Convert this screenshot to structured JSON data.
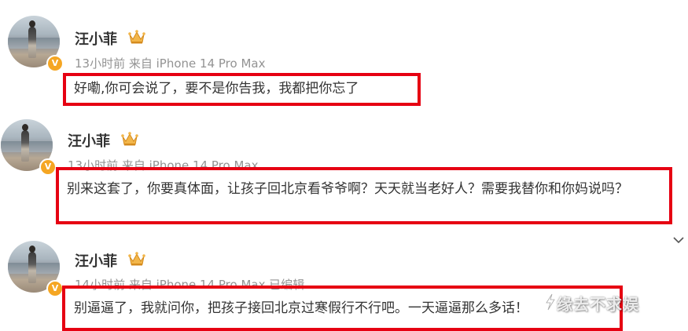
{
  "comments": [
    {
      "username": "汪小菲",
      "meta": "13小时前 来自 iPhone 14 Pro Max",
      "content": "好嘞,你可会说了，要不是你告我，我都把你忘了"
    },
    {
      "username": "汪小菲",
      "meta": "13小时前 来自 iPhone 14 Pro Max",
      "content": "别来这套了，你要真体面，让孩子回北京看爷爷啊？天天就当老好人？需要我替你和你妈说吗？"
    },
    {
      "username": "汪小菲",
      "meta": "14小时前 来自 iPhone 14 Pro Max 已编辑",
      "content": "别逼逼了，我就问你，把孩子接回北京过寒假行不行吧。一天逼逼那么多话！"
    }
  ],
  "verified_badge": "V",
  "watermark": "缘去不求娱",
  "colors": {
    "highlight": "#e60012",
    "meta": "#939393",
    "text": "#333333",
    "badge": "#f5a623"
  },
  "icons": [
    "crown-icon",
    "verified-badge-icon",
    "chevron-down-icon"
  ]
}
